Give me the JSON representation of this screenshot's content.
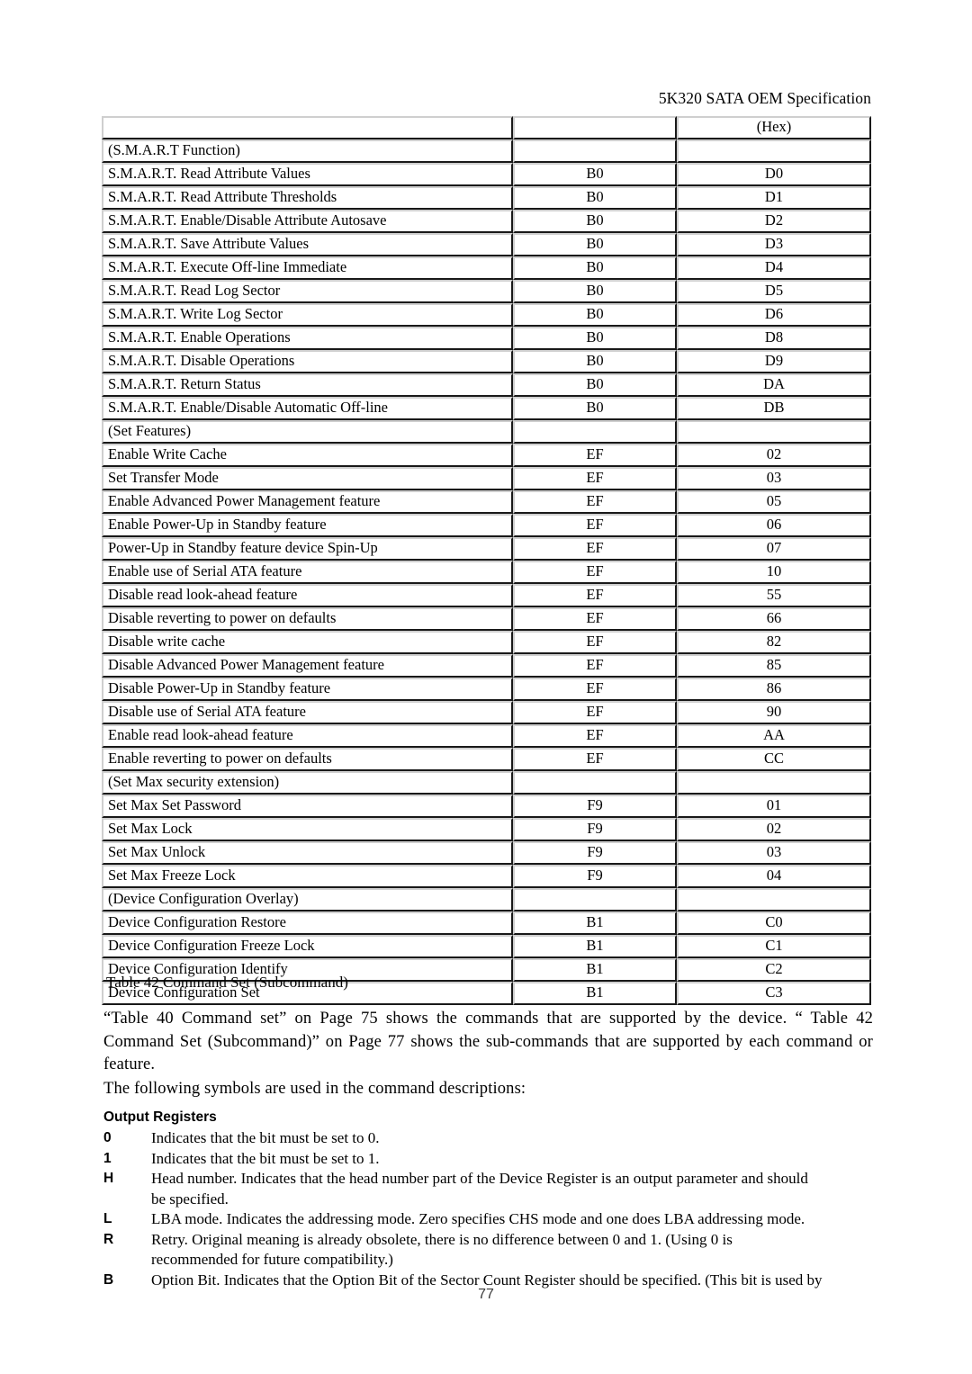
{
  "header": {
    "running_title": "5K320 SATA OEM Specification"
  },
  "table": {
    "caption": "Table 42 Command Set (Subcommand)",
    "header_row": [
      "",
      "",
      "(Hex)"
    ],
    "rows": [
      {
        "name": "(S.M.A.R.T Function)",
        "cmd": "",
        "hex": "",
        "group": true
      },
      {
        "name": "S.M.A.R.T. Read Attribute Values",
        "cmd": "B0",
        "hex": "D0",
        "group": false
      },
      {
        "name": "S.M.A.R.T. Read Attribute Thresholds",
        "cmd": "B0",
        "hex": "D1",
        "group": false
      },
      {
        "name": "S.M.A.R.T. Enable/Disable Attribute Autosave",
        "cmd": "B0",
        "hex": "D2",
        "group": false
      },
      {
        "name": "S.M.A.R.T. Save Attribute Values",
        "cmd": "B0",
        "hex": "D3",
        "group": false
      },
      {
        "name": "S.M.A.R.T. Execute Off-line Immediate",
        "cmd": "B0",
        "hex": "D4",
        "group": false
      },
      {
        "name": "S.M.A.R.T. Read Log Sector",
        "cmd": "B0",
        "hex": "D5",
        "group": false
      },
      {
        "name": "S.M.A.R.T. Write Log Sector",
        "cmd": "B0",
        "hex": "D6",
        "group": false
      },
      {
        "name": "S.M.A.R.T. Enable Operations",
        "cmd": "B0",
        "hex": "D8",
        "group": false
      },
      {
        "name": "S.M.A.R.T. Disable Operations",
        "cmd": "B0",
        "hex": "D9",
        "group": false
      },
      {
        "name": "S.M.A.R.T. Return Status",
        "cmd": "B0",
        "hex": "DA",
        "group": false
      },
      {
        "name": "S.M.A.R.T. Enable/Disable Automatic Off-line",
        "cmd": "B0",
        "hex": "DB",
        "group": false
      },
      {
        "name": "(Set Features)",
        "cmd": "",
        "hex": "",
        "group": true
      },
      {
        "name": "Enable Write Cache",
        "cmd": "EF",
        "hex": "02",
        "group": false
      },
      {
        "name": "Set Transfer Mode",
        "cmd": "EF",
        "hex": "03",
        "group": false
      },
      {
        "name": "Enable Advanced Power Management feature",
        "cmd": "EF",
        "hex": "05",
        "group": false
      },
      {
        "name": "Enable Power-Up in Standby feature",
        "cmd": "EF",
        "hex": "06",
        "group": false
      },
      {
        "name": "Power-Up in Standby feature device Spin-Up",
        "cmd": "EF",
        "hex": "07",
        "group": false
      },
      {
        "name": "Enable use of Serial ATA feature",
        "cmd": "EF",
        "hex": "10",
        "group": false
      },
      {
        "name": "Disable read look-ahead feature",
        "cmd": "EF",
        "hex": "55",
        "group": false
      },
      {
        "name": "Disable reverting to power on defaults",
        "cmd": "EF",
        "hex": "66",
        "group": false
      },
      {
        "name": "Disable write cache",
        "cmd": "EF",
        "hex": "82",
        "group": false
      },
      {
        "name": "Disable Advanced Power Management feature",
        "cmd": "EF",
        "hex": "85",
        "group": false
      },
      {
        "name": "Disable Power-Up in Standby feature",
        "cmd": "EF",
        "hex": "86",
        "group": false
      },
      {
        "name": "Disable use of Serial ATA feature",
        "cmd": "EF",
        "hex": "90",
        "group": false
      },
      {
        "name": "Enable read look-ahead feature",
        "cmd": "EF",
        "hex": "AA",
        "group": false
      },
      {
        "name": "Enable reverting to power on defaults",
        "cmd": "EF",
        "hex": "CC",
        "group": false
      },
      {
        "name": "(Set Max security extension)",
        "cmd": "",
        "hex": "",
        "group": true
      },
      {
        "name": "Set Max Set Password",
        "cmd": "F9",
        "hex": "01",
        "group": false
      },
      {
        "name": "Set Max Lock",
        "cmd": "F9",
        "hex": "02",
        "group": false
      },
      {
        "name": "Set Max Unlock",
        "cmd": "F9",
        "hex": "03",
        "group": false
      },
      {
        "name": "Set Max Freeze Lock",
        "cmd": "F9",
        "hex": "04",
        "group": false
      },
      {
        "name": "(Device Configuration Overlay)",
        "cmd": "",
        "hex": "",
        "group": true
      },
      {
        "name": "Device Configuration Restore",
        "cmd": "B1",
        "hex": "C0",
        "group": false
      },
      {
        "name": "Device Configuration Freeze Lock",
        "cmd": "B1",
        "hex": "C1",
        "group": false
      },
      {
        "name": "Device Configuration Identify",
        "cmd": "B1",
        "hex": "C2",
        "group": false
      },
      {
        "name": "Device Configuration Set",
        "cmd": "B1",
        "hex": "C3",
        "group": false
      }
    ]
  },
  "body": {
    "paragraph_1": "“Table 40 Command set” on Page 75 shows the commands that are supported by the device. “ Table 42 Command Set (Subcommand)” on Page 77 shows the sub-commands that are supported by each command or feature.",
    "paragraph_2": "The following symbols are used in the command descriptions:",
    "subheading": "Output Registers",
    "definitions": [
      {
        "symbol": "0",
        "text": "Indicates that the bit must be set to 0.",
        "continuation": ""
      },
      {
        "symbol": "1",
        "text": "Indicates that the bit must be set to 1.",
        "continuation": ""
      },
      {
        "symbol": "H",
        "text": "Head number. Indicates that the head number part of the Device Register is an output parameter and should",
        "continuation": "be specified."
      },
      {
        "symbol": "L",
        "text": "LBA mode. Indicates the addressing mode. Zero specifies CHS mode and one does LBA addressing mode.",
        "continuation": ""
      },
      {
        "symbol": "R",
        "text": "Retry. Original meaning is already obsolete, there is no difference between 0 and 1. (Using 0 is",
        "continuation": "recommended for future compatibility.)"
      },
      {
        "symbol": "B",
        "text": "Option Bit. Indicates that the Option Bit of the Sector Count Register should be specified. (This bit is used by",
        "continuation": ""
      }
    ]
  },
  "footer": {
    "page_number": "77"
  }
}
